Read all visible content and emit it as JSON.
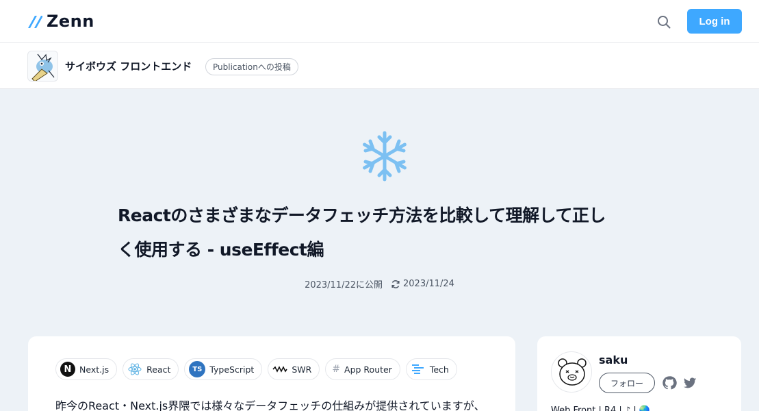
{
  "header": {
    "logo_text": "Zenn",
    "login_label": "Log in",
    "brand_color": "#3ea8ff"
  },
  "publication": {
    "name": "サイボウズ フロントエンド",
    "badge": "Publicationへの投稿"
  },
  "article": {
    "emoji": "snowflake",
    "title_line1": "Reactのさまざまなデータフェッチ方法を比較して理解して正し",
    "title_line2": "く使用する - useEffect編",
    "published": "2023/11/22に公開",
    "updated": "2023/11/24",
    "topics": [
      {
        "label": "Next.js",
        "icon": "nextjs-icon"
      },
      {
        "label": "React",
        "icon": "react-icon"
      },
      {
        "label": "TypeScript",
        "icon": "typescript-icon"
      },
      {
        "label": "SWR",
        "icon": "swr-icon"
      },
      {
        "label": "App Router",
        "icon": "hash-icon"
      },
      {
        "label": "Tech",
        "icon": "tech-icon"
      }
    ],
    "intro": "昨今のReact・Next.js界隈では様々なデータフェッチの仕組みが提供されていますが、"
  },
  "author": {
    "name": "saku",
    "follow_label": "フォロー",
    "bio": "Web Front | R4 | ♪ | 🌏"
  }
}
